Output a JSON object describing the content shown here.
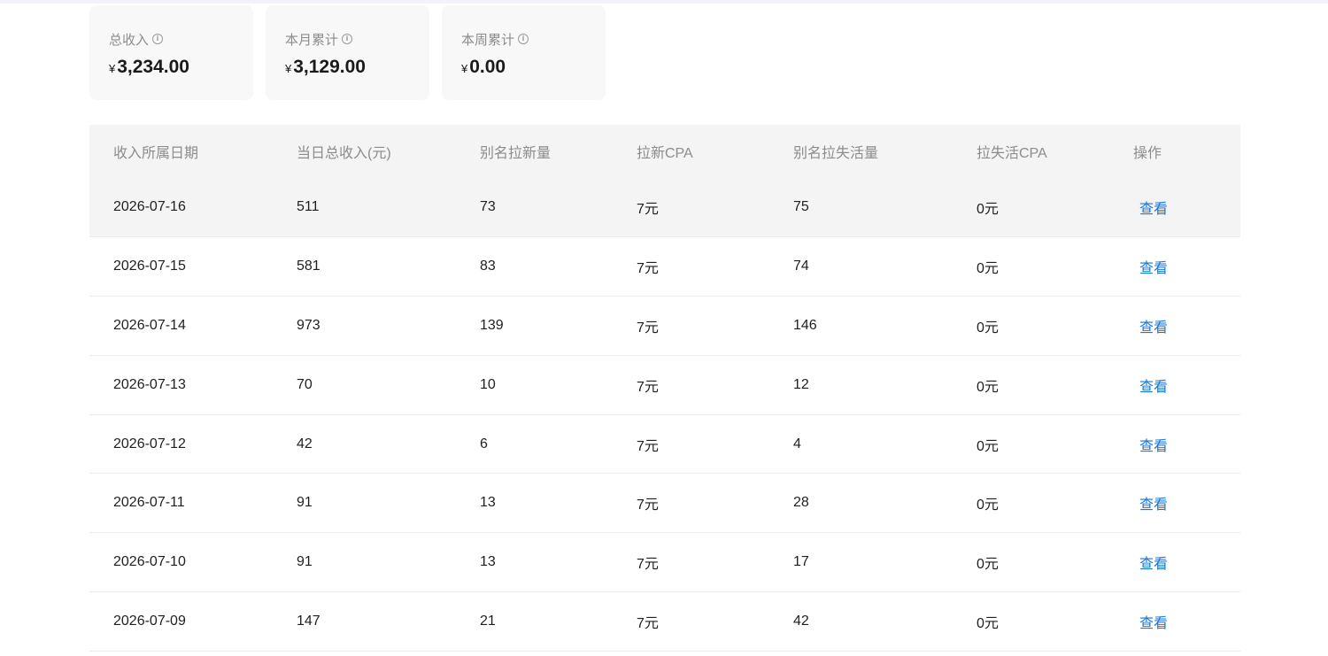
{
  "stats": [
    {
      "label": "总收入",
      "currency": "¥",
      "value": "3,234.00"
    },
    {
      "label": "本月累计",
      "currency": "¥",
      "value": "3,129.00"
    },
    {
      "label": "本周累计",
      "currency": "¥",
      "value": "0.00"
    }
  ],
  "info_icon_glyph": "i",
  "table": {
    "headers": [
      "收入所属日期",
      "当日总收入(元)",
      "别名拉新量",
      "拉新CPA",
      "别名拉失活量",
      "拉失活CPA",
      "操作"
    ],
    "rows": [
      {
        "date": "2026-07-16",
        "income": "511",
        "new": "73",
        "cpa": "7元",
        "lost": "75",
        "lost_cpa": "0元",
        "action": "查看"
      },
      {
        "date": "2026-07-15",
        "income": "581",
        "new": "83",
        "cpa": "7元",
        "lost": "74",
        "lost_cpa": "0元",
        "action": "查看"
      },
      {
        "date": "2026-07-14",
        "income": "973",
        "new": "139",
        "cpa": "7元",
        "lost": "146",
        "lost_cpa": "0元",
        "action": "查看"
      },
      {
        "date": "2026-07-13",
        "income": "70",
        "new": "10",
        "cpa": "7元",
        "lost": "12",
        "lost_cpa": "0元",
        "action": "查看"
      },
      {
        "date": "2026-07-12",
        "income": "42",
        "new": "6",
        "cpa": "7元",
        "lost": "4",
        "lost_cpa": "0元",
        "action": "查看"
      },
      {
        "date": "2026-07-11",
        "income": "91",
        "new": "13",
        "cpa": "7元",
        "lost": "28",
        "lost_cpa": "0元",
        "action": "查看"
      },
      {
        "date": "2026-07-10",
        "income": "91",
        "new": "13",
        "cpa": "7元",
        "lost": "17",
        "lost_cpa": "0元",
        "action": "查看"
      },
      {
        "date": "2026-07-09",
        "income": "147",
        "new": "21",
        "cpa": "7元",
        "lost": "42",
        "lost_cpa": "0元",
        "action": "查看"
      }
    ]
  },
  "colors": {
    "link": "#1677d6",
    "header_bg": "#f4f4f4",
    "card_bg": "#f8f8f8"
  }
}
